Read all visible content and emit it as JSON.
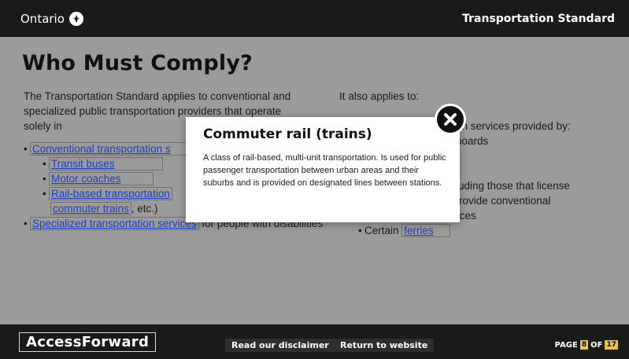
{
  "header": {
    "brand": "Ontario",
    "standard_title": "Transportation Standard"
  },
  "page": {
    "title": "Who Must Comply?"
  },
  "left": {
    "intro": "The Transportation Standard applies to conventional and specialized public transportation providers that operate solely in",
    "items": [
      {
        "link": "Conventional transportation s"
      },
      {
        "link": "Transit buses"
      },
      {
        "link": "Motor coaches"
      },
      {
        "link": "Rail-based transportation",
        "link2": "commuter trains",
        "suffix": ", etc.)"
      },
      {
        "link": "Specialized transportation services",
        "suffix": " for people with disabilities"
      }
    ]
  },
  "right": {
    "intro": "It also applies to:",
    "line1": "on services provided by:",
    "line2": "boards",
    "line3": "luding those that license",
    "line4": "rovide conventional",
    "line5": "transportation services",
    "ferries_prefix": "Certain ",
    "ferries_link": "ferries"
  },
  "modal": {
    "title": "Commuter rail (trains)",
    "body": "A class of rail-based, multi-unit transportation. Is used for public passenger transportation between urban areas and their suburbs and is provided on designated lines between stations."
  },
  "footer": {
    "brand": "AccessForward",
    "disclaimer": "Read our disclaimer",
    "return": "Return to website",
    "page_label": "PAGE",
    "page_current": "8",
    "of_label": "OF",
    "page_total": "17"
  },
  "colors": {
    "link": "#1d3fbf",
    "overlay": "#9b9b9b",
    "bar": "#1a1a1a",
    "page_badge": "#e7c24a"
  }
}
